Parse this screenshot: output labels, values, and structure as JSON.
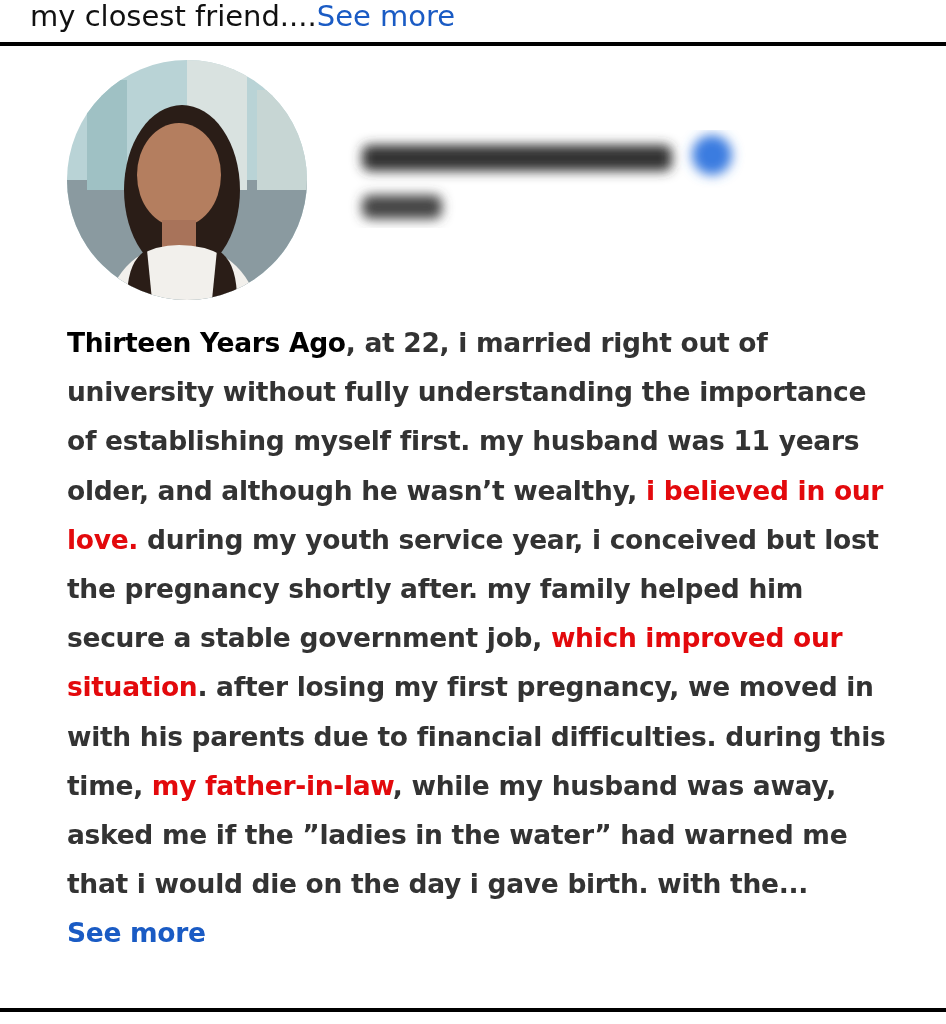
{
  "previous_post": {
    "text": "my closest friend....",
    "link": "See more"
  },
  "post": {
    "body": [
      {
        "kind": "bold",
        "text": "Thirteen Years Ago"
      },
      {
        "kind": "normal",
        "text": ", at 22, i married right out of university without fully understanding the importance of establishing myself first. my husband was 11 years older, and although he wasn’t wealthy, "
      },
      {
        "kind": "highlight",
        "text": "i believed in our love."
      },
      {
        "kind": "normal",
        "text": " during my youth service year, i conceived but lost the pregnancy shortly after. my family helped him secure a stable government job, "
      },
      {
        "kind": "highlight",
        "text": "which improved our situation"
      },
      {
        "kind": "normal",
        "text": ". after losing my first pregnancy, we moved in with his parents due to financial difficulties. during this time, "
      },
      {
        "kind": "highlight",
        "text": "my father-in-law"
      },
      {
        "kind": "normal",
        "text": ", while my husband was away, asked me if the ”ladies in the water” had warned me that i would die on the day i gave birth. with the..."
      }
    ],
    "link": "See more"
  }
}
